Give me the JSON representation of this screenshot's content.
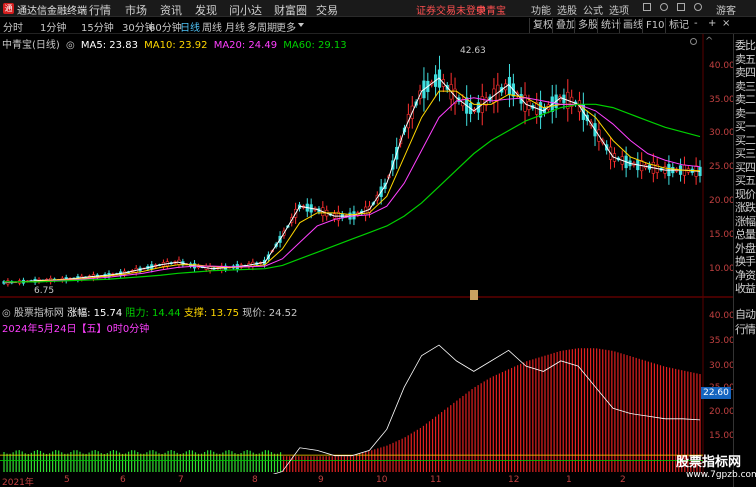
{
  "title_bar": {
    "app_name": "通达信金融终端",
    "menus": [
      "行情",
      "市场",
      "资讯",
      "发现",
      "问小达",
      "财富圈",
      "交易"
    ],
    "login_notice": "证券交易未登录",
    "brand": "中青宝",
    "right_menus": [
      "功能",
      "选股",
      "公式",
      "选项",
      "游客"
    ]
  },
  "toolbar": {
    "periods": [
      "分时",
      "1分钟",
      "15分钟",
      "30分钟",
      "60分钟",
      "日线",
      "周线",
      "月线",
      "多周期",
      "更多"
    ],
    "active_period": "日线",
    "buttons": [
      "复权",
      "叠加",
      "多股",
      "统计",
      "画线",
      "F10",
      "标记"
    ],
    "win_icons": [
      "-",
      "+",
      "×"
    ]
  },
  "ma_legend": {
    "stock_label": "中青宝(日线)",
    "ma5": "MA5: 23.83",
    "ma10": "MA10: 23.92",
    "ma20": "MA20: 24.49",
    "ma60": "MA60: 29.13",
    "colors": {
      "ma5": "#ffffff",
      "ma10": "#ffd700",
      "ma20": "#ff40ff",
      "ma60": "#00d000"
    }
  },
  "price_axis": {
    "labels": [
      "40.00",
      "35.00",
      "30.00",
      "25.00",
      "20.00",
      "15.00",
      "10.00"
    ],
    "high_marker": "42.63",
    "low_marker": "6.75"
  },
  "indicator": {
    "name": "股票指标网",
    "gap": "涨幅: 15.74",
    "resistance": "阻力: 14.44",
    "support": "支撑: 13.75",
    "price": "现价: 24.52",
    "date": "2024年5月24日【五】0时0分钟",
    "axis_labels": [
      "40.00",
      "35.00",
      "30.00",
      "25.00",
      "20.00",
      "15.00"
    ],
    "current_box": "22.60"
  },
  "x_axis": {
    "labels": [
      "2021年",
      "5",
      "6",
      "7",
      "8",
      "9",
      "10",
      "11",
      "12",
      "1",
      "2"
    ]
  },
  "right_panel": {
    "items": [
      "委比",
      "卖五",
      "卖四",
      "卖三",
      "卖二",
      "卖一",
      "买一",
      "买二",
      "买三",
      "买四",
      "买五",
      "现价",
      "涨跌",
      "涨幅",
      "总量",
      "外盘",
      "换手",
      "净资",
      "收益"
    ],
    "bottom_items": [
      "自动",
      "行情"
    ]
  },
  "watermark": {
    "title": "股票指标网",
    "url": "www.7gpzb.com"
  },
  "chart_data": {
    "type": "line",
    "title": "",
    "ylim": [
      5,
      45
    ],
    "series": [
      {
        "name": "MA5",
        "values": [
          6.9,
          7.0,
          7.2,
          7.3,
          7.5,
          7.8,
          8.0,
          8.4,
          9.0,
          9.6,
          10.0,
          9.4,
          9.0,
          9.2,
          9.5,
          10.0,
          14.0,
          18.5,
          18.0,
          17.0,
          17.0,
          18.0,
          22.0,
          30.0,
          36.0,
          38.0,
          35.0,
          33.0,
          35.0,
          37.0,
          34.0,
          33.0,
          35.0,
          34.0,
          30.0,
          26.0,
          25.0,
          24.5,
          24.0,
          24.0,
          23.8
        ]
      },
      {
        "name": "MA10",
        "values": [
          6.9,
          7.0,
          7.1,
          7.3,
          7.4,
          7.6,
          7.9,
          8.2,
          8.6,
          9.2,
          9.6,
          9.6,
          9.3,
          9.2,
          9.3,
          9.6,
          12.0,
          16.0,
          17.5,
          17.5,
          17.2,
          17.5,
          20.0,
          26.0,
          32.0,
          36.0,
          36.0,
          34.0,
          34.0,
          35.5,
          35.0,
          33.5,
          34.0,
          34.0,
          32.0,
          28.5,
          26.0,
          25.0,
          24.3,
          24.0,
          23.9
        ]
      },
      {
        "name": "MA20",
        "values": [
          6.9,
          7.0,
          7.0,
          7.2,
          7.3,
          7.5,
          7.7,
          8.0,
          8.3,
          8.8,
          9.2,
          9.4,
          9.4,
          9.3,
          9.3,
          9.4,
          10.5,
          13.0,
          15.5,
          16.5,
          17.0,
          17.2,
          18.5,
          22.0,
          27.0,
          32.0,
          34.5,
          35.0,
          34.5,
          34.8,
          35.0,
          34.5,
          34.0,
          34.0,
          33.0,
          31.0,
          28.5,
          26.5,
          25.5,
          24.8,
          24.5
        ]
      },
      {
        "name": "MA60",
        "values": [
          7.0,
          7.0,
          7.0,
          7.1,
          7.2,
          7.3,
          7.4,
          7.6,
          7.8,
          8.0,
          8.3,
          8.5,
          8.7,
          8.8,
          8.9,
          9.0,
          9.5,
          10.5,
          11.5,
          12.5,
          13.5,
          14.5,
          15.5,
          17.0,
          19.0,
          21.5,
          24.0,
          26.5,
          28.5,
          30.0,
          31.5,
          32.5,
          33.5,
          34.0,
          34.0,
          33.5,
          32.5,
          31.5,
          30.5,
          29.8,
          29.1
        ]
      }
    ]
  }
}
